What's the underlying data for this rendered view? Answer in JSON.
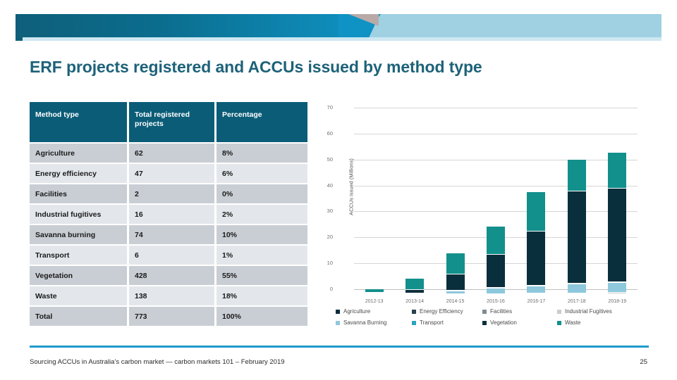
{
  "slide": {
    "title": "ERF projects registered and ACCUs issued by method   type",
    "footer_text": "Sourcing ACCUs in Australia’s carbon market — carbon markets 101  – February 2019",
    "page_number": "25"
  },
  "colors": {
    "brand_dark": "#0b5c77",
    "brand_blue": "#0f93c4",
    "brand_light": "#9fd1e3",
    "title": "#1d6279",
    "teal": "#12908c",
    "navy": "#0a2f3c",
    "lightblue": "#8dc8dd",
    "rule": "#1e9ccc"
  },
  "table": {
    "headers": [
      "Method type",
      "Total registered projects",
      "Percentage"
    ],
    "rows": [
      [
        "Agriculture",
        "62",
        "8%"
      ],
      [
        "Energy efficiency",
        "47",
        "6%"
      ],
      [
        "Facilities",
        "2",
        "0%"
      ],
      [
        "Industrial fugitives",
        "16",
        "2%"
      ],
      [
        "Savanna burning",
        "74",
        "10%"
      ],
      [
        "Transport",
        "6",
        "1%"
      ],
      [
        "Vegetation",
        "428",
        "55%"
      ],
      [
        "Waste",
        "138",
        "18%"
      ],
      [
        "Total",
        "773",
        "100%"
      ]
    ]
  },
  "chart_data": {
    "type": "bar",
    "stacked": true,
    "title": "",
    "xlabel": "",
    "ylabel": "ACCUs issued (Millions)",
    "ylim": [
      0,
      70
    ],
    "yticks": [
      0,
      10,
      20,
      30,
      40,
      50,
      60,
      70
    ],
    "grid": true,
    "legend_position": "bottom",
    "categories": [
      "2012-13",
      "2013-14",
      "2014-15",
      "2015-16",
      "2016-17",
      "2017-18",
      "2018-19"
    ],
    "series": [
      {
        "name": "Agriculture",
        "color": "#0a2f3c",
        "values": [
          0.05,
          0.1,
          0.15,
          0.2,
          0.25,
          0.3,
          0.35
        ]
      },
      {
        "name": "Energy Efficiency",
        "color": "#27424c",
        "values": [
          0.02,
          0.05,
          0.08,
          0.1,
          0.12,
          0.15,
          0.18
        ]
      },
      {
        "name": "Facilities",
        "color": "#7f8c91",
        "values": [
          0.0,
          0.0,
          0.0,
          0.0,
          0.02,
          0.05,
          0.08
        ]
      },
      {
        "name": "Industrial Fugitives",
        "color": "#c8cdd0",
        "values": [
          0.05,
          0.1,
          0.15,
          0.2,
          0.25,
          0.3,
          0.35
        ]
      },
      {
        "name": "Savanna Burning",
        "color": "#8dc8dd",
        "values": [
          0.1,
          0.2,
          1.2,
          2.3,
          2.6,
          3.4,
          3.9
        ]
      },
      {
        "name": "Transport",
        "color": "#2aa3c4",
        "values": [
          0.0,
          0.0,
          0.02,
          0.05,
          0.05,
          0.08,
          0.1
        ]
      },
      {
        "name": "Vegetation",
        "color": "#0a2f3c",
        "values": [
          0.1,
          1.4,
          6.0,
          12.5,
          21.0,
          35.5,
          36.0
        ]
      },
      {
        "name": "Waste",
        "color": "#12908c",
        "values": [
          1.3,
          4.3,
          8.2,
          11.0,
          15.2,
          12.3,
          14.0
        ]
      }
    ],
    "totals": [
      1.6,
      6.1,
      15.8,
      26.3,
      39.5,
      52.1,
      55.0
    ]
  },
  "legend": {
    "row1": [
      "Agriculture",
      "Energy Efficiency",
      "Facilities",
      "Industrial Fugitives"
    ],
    "row2": [
      "Savanna Burning",
      "Transport",
      "Vegetation",
      "Waste"
    ]
  }
}
